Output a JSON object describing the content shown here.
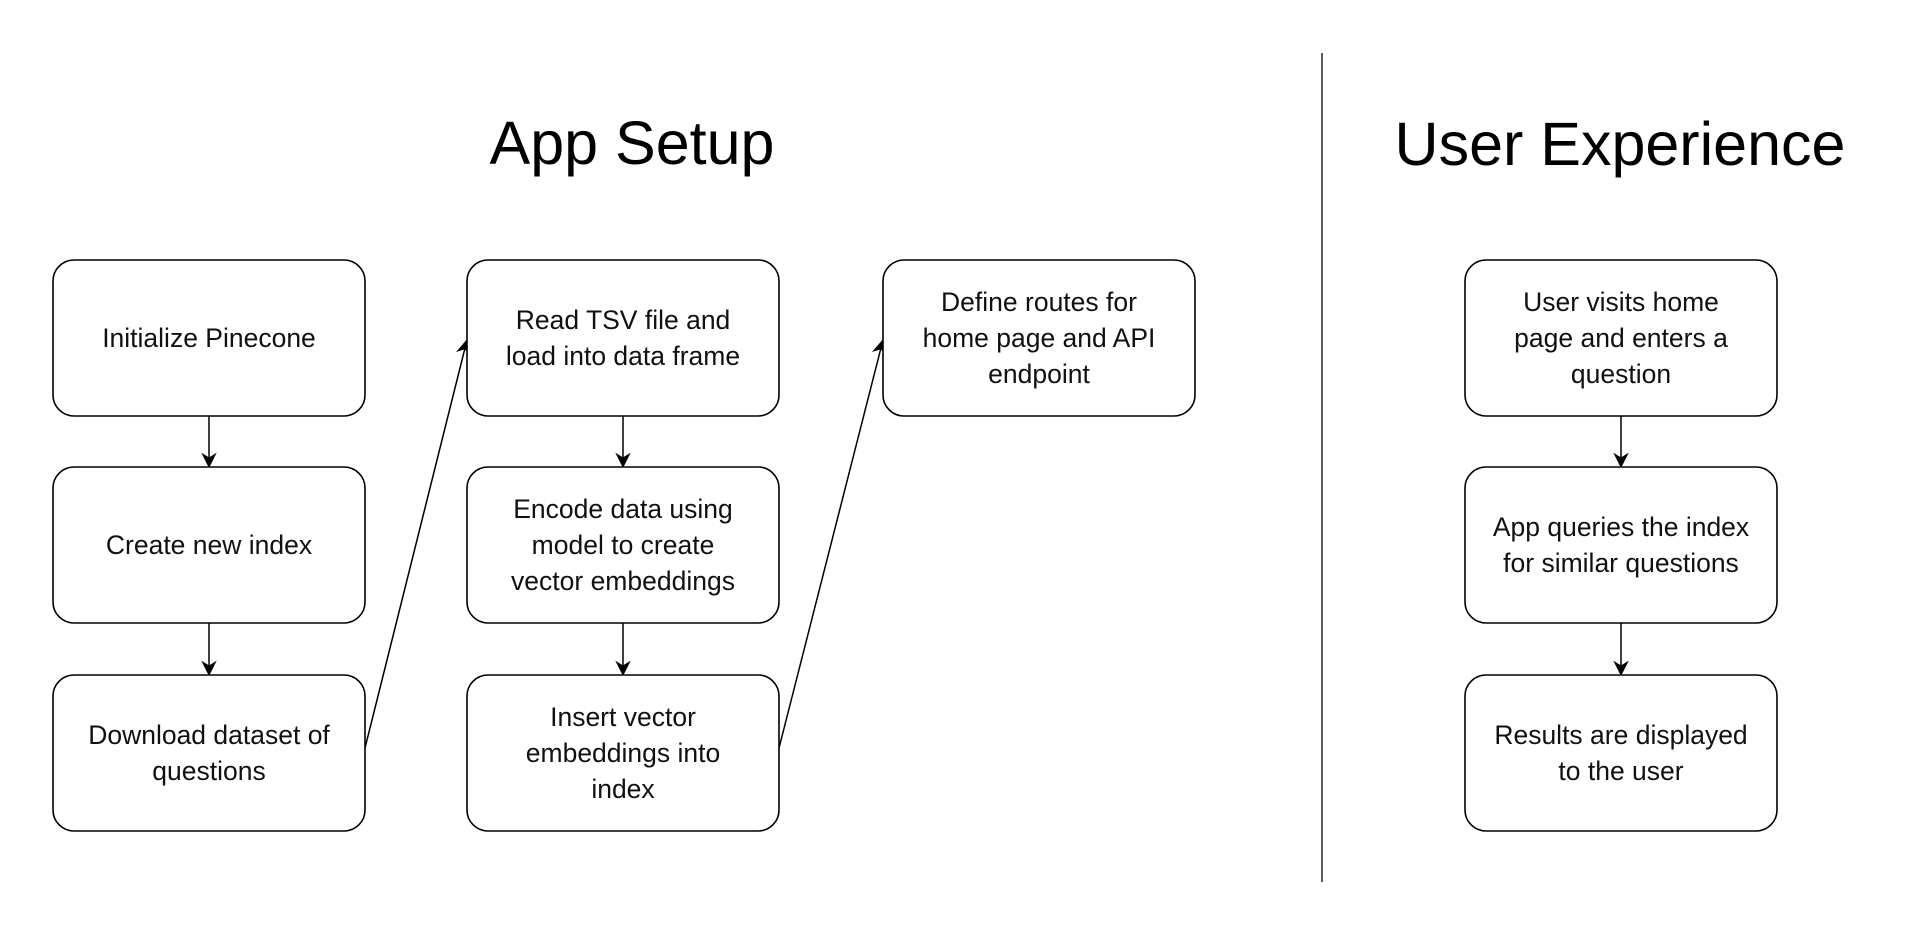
{
  "sections": [
    {
      "id": "app-setup",
      "title": "App Setup",
      "steps": [
        {
          "id": "init",
          "lines": [
            "Initialize Pinecone"
          ]
        },
        {
          "id": "create-index",
          "lines": [
            "Create new index"
          ]
        },
        {
          "id": "download",
          "lines": [
            "Download dataset of",
            "questions"
          ]
        },
        {
          "id": "read-tsv",
          "lines": [
            "Read TSV file and",
            "load into data frame"
          ]
        },
        {
          "id": "encode",
          "lines": [
            "Encode data using",
            "model to create",
            "vector embeddings"
          ]
        },
        {
          "id": "insert",
          "lines": [
            "Insert vector",
            "embeddings into",
            "index"
          ]
        },
        {
          "id": "routes",
          "lines": [
            "Define routes for",
            "home page and API",
            "endpoint"
          ]
        }
      ],
      "edges": [
        [
          "init",
          "create-index"
        ],
        [
          "create-index",
          "download"
        ],
        [
          "download",
          "read-tsv"
        ],
        [
          "read-tsv",
          "encode"
        ],
        [
          "encode",
          "insert"
        ],
        [
          "insert",
          "routes"
        ]
      ]
    },
    {
      "id": "user-experience",
      "title": "User Experience",
      "steps": [
        {
          "id": "visit",
          "lines": [
            "User visits home",
            "page and enters a",
            "question"
          ]
        },
        {
          "id": "query",
          "lines": [
            "App queries the index",
            "for similar questions"
          ]
        },
        {
          "id": "results",
          "lines": [
            "Results are displayed",
            "to the user"
          ]
        }
      ],
      "edges": [
        [
          "visit",
          "query"
        ],
        [
          "query",
          "results"
        ]
      ]
    }
  ]
}
